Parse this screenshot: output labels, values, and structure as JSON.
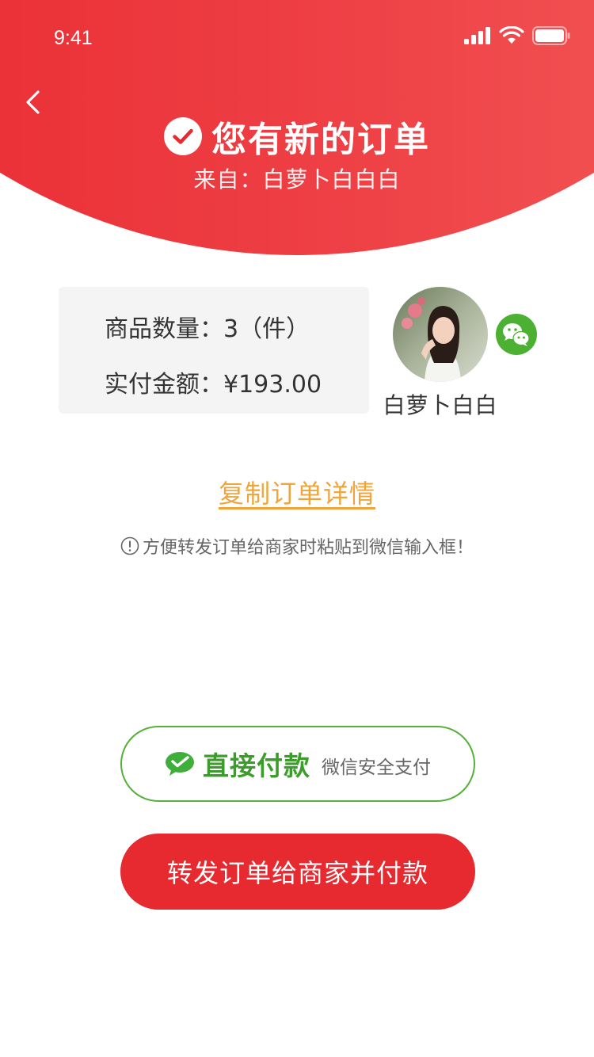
{
  "status_bar": {
    "time": "9:41"
  },
  "header": {
    "title": "您有新的订单",
    "subtitle": "来自：白萝卜白白白"
  },
  "order": {
    "quantity_label": "商品数量：",
    "quantity_value": "3（件）",
    "amount_label": "实付金额：",
    "amount_value": "¥193.00"
  },
  "buyer": {
    "name": "白萝卜白白",
    "badge_icon": "wechat-icon"
  },
  "copy_link": "复制订单详情",
  "tip": "方便转发订单给商家时粘贴到微信输入框！",
  "pay_button": {
    "label": "直接付款",
    "sub_label": "微信安全支付",
    "icon": "wechat-pay-icon"
  },
  "forward_button": {
    "label": "转发订单给商家并付款"
  },
  "colors": {
    "brand_red": "#e72a30",
    "wechat_green": "#4cb132",
    "link_orange": "#f0a53b",
    "card_bg": "#f4f4f4"
  }
}
